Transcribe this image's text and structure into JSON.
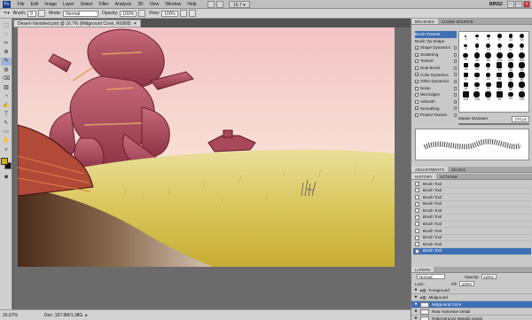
{
  "app": {
    "logo": "Ps",
    "workspace": "BINS2",
    "zoom": "16.7"
  },
  "menu": [
    "File",
    "Edit",
    "Image",
    "Layer",
    "Select",
    "Filter",
    "Analysis",
    "3D",
    "View",
    "Window",
    "Help"
  ],
  "options": {
    "brush_label": "Brush:",
    "brush_size": "9",
    "mode_label": "Mode:",
    "mode_value": "Normal",
    "opacity_label": "Opacity:",
    "opacity_value": "100%",
    "flow_label": "Flow:",
    "flow_value": "100%"
  },
  "document": {
    "tab_title": "Desert-Vanished.psd @ 16.7% (Midground Conn, RGB/8)",
    "close": "×"
  },
  "status": {
    "zoom": "16.67%",
    "doc": "Doc: 187.8M/1.38G"
  },
  "toolbox": {
    "tools": [
      "⬚",
      "◌",
      "✂",
      "⊕",
      "✎",
      "◍",
      "⌫",
      "▥",
      "◔",
      "✍",
      "T",
      "↖",
      "▭",
      "✋",
      "⌕"
    ]
  },
  "brushes_panel": {
    "tabs": [
      "BRUSHES",
      "CLONE SOURCE"
    ],
    "items": [
      {
        "label": "Brush Presets",
        "checked": false,
        "selected": true
      },
      {
        "label": "Brush Tip Shape",
        "checked": false,
        "selected": false
      },
      {
        "label": "Shape Dynamics",
        "checked": true,
        "selected": false
      },
      {
        "label": "Scattering",
        "checked": true,
        "selected": false
      },
      {
        "label": "Texture",
        "checked": false,
        "selected": false
      },
      {
        "label": "Dual Brush",
        "checked": false,
        "selected": false
      },
      {
        "label": "Color Dynamics",
        "checked": true,
        "selected": false
      },
      {
        "label": "Other Dynamics",
        "checked": true,
        "selected": false
      },
      {
        "label": "Noise",
        "checked": false,
        "selected": false
      },
      {
        "label": "Wet Edges",
        "checked": false,
        "selected": false
      },
      {
        "label": "Airbrush",
        "checked": false,
        "selected": false
      },
      {
        "label": "Smoothing",
        "checked": true,
        "selected": false
      },
      {
        "label": "Protect Texture",
        "checked": false,
        "selected": false
      }
    ],
    "tip_sizes": [
      "1",
      "3",
      "5",
      "9",
      "13",
      "19",
      "5",
      "9",
      "13",
      "17",
      "21",
      "27",
      "35",
      "45",
      "65",
      "100",
      "200",
      "300",
      "14",
      "24",
      "27",
      "39",
      "46",
      "59",
      "11",
      "17",
      "23",
      "36",
      "44",
      "60",
      "14",
      "26",
      "33",
      "42",
      "55",
      "70",
      "112",
      "134",
      "74",
      "95",
      "29",
      "192"
    ],
    "master_diameter_label": "Master Diameter",
    "master_diameter_value": "270 px"
  },
  "adjustments_panel": {
    "tabs": [
      "ADJUSTMENTS",
      "MASKS"
    ]
  },
  "history_panel": {
    "tabs": [
      "HISTORY",
      "ACTIONS"
    ],
    "items": [
      "Brush Tool",
      "Brush Tool",
      "Brush Tool",
      "Brush Tool",
      "Brush Tool",
      "Brush Tool",
      "Brush Tool",
      "Brush Tool",
      "Brush Tool",
      "Brush Tool",
      "Brush Tool"
    ],
    "selected_index": 10
  },
  "layers_panel": {
    "tabs": [
      "LAYERS"
    ],
    "blend_mode": "Normal",
    "opacity_label": "Opacity:",
    "opacity_value": "100%",
    "lock_label": "Lock:",
    "fill_label": "Fill:",
    "fill_value": "100%",
    "layers": [
      {
        "name": "Foreground",
        "type": "group",
        "selected": false
      },
      {
        "name": "Midground",
        "type": "group",
        "selected": false
      },
      {
        "name": "Midground Conn",
        "type": "layer",
        "selected": true
      },
      {
        "name": "Rear Harvester Detail",
        "type": "layer",
        "selected": false
      },
      {
        "name": "Robot Bronze Metallic Detail",
        "type": "layer",
        "selected": false
      }
    ]
  },
  "colors": {
    "foreground": "#d8b400",
    "background": "#111111",
    "selection": "#3d6fb5"
  }
}
